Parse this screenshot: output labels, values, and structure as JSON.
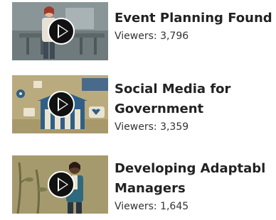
{
  "courses": [
    {
      "title": "Event Planning Found",
      "viewers_label": "Viewers:",
      "viewers": "3,796"
    },
    {
      "title": "Social Media for Government",
      "viewers_label": "Viewers:",
      "viewers": "3,359"
    },
    {
      "title": "Developing Adaptabl Managers",
      "viewers_label": "Viewers:",
      "viewers": "1,645"
    }
  ],
  "colors": {
    "title": "#222222",
    "text": "#333333",
    "play_button": "#111111"
  },
  "icons": [
    "play-icon"
  ]
}
